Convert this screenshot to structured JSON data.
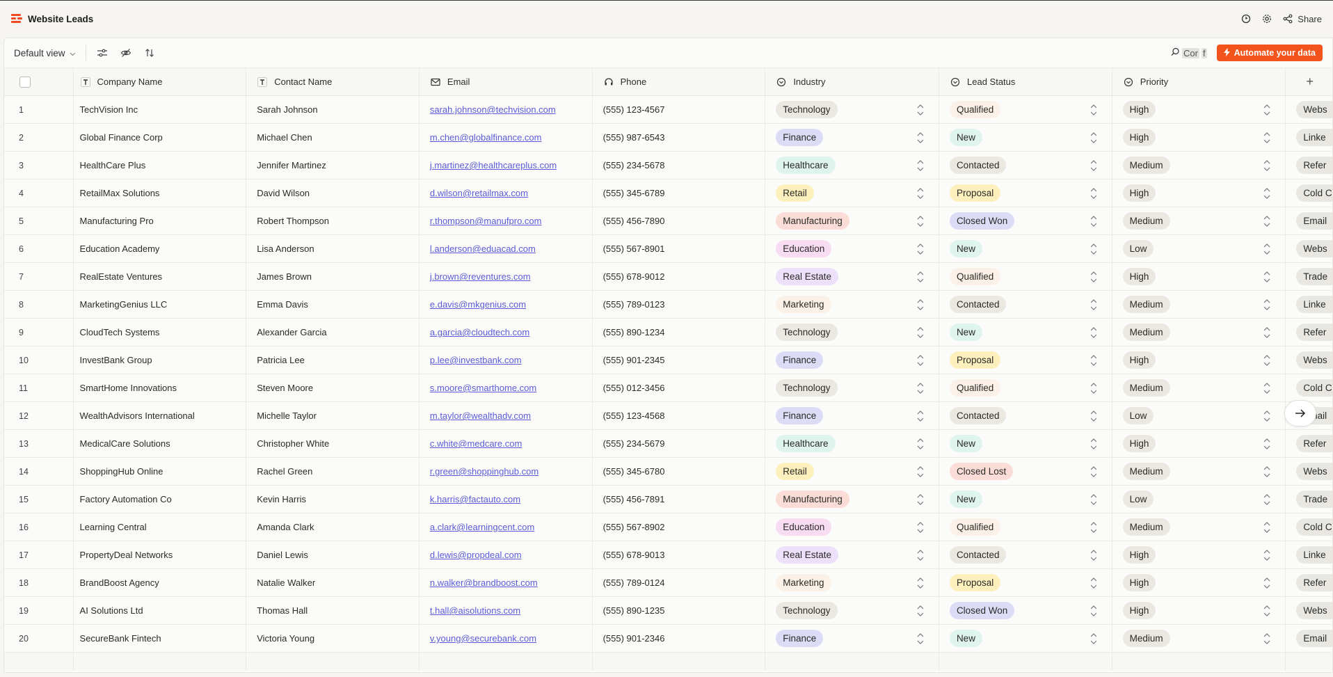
{
  "app": {
    "title": "Website Leads",
    "share_label": "Share"
  },
  "toolbar": {
    "view_label": "Default view",
    "search_text": "Cor",
    "search_highlight": "f",
    "automate_label": "Automate your data"
  },
  "columns": [
    {
      "label": "Company Name",
      "icon": "text-type-icon"
    },
    {
      "label": "Contact Name",
      "icon": "text-type-icon"
    },
    {
      "label": "Email",
      "icon": "mail-icon"
    },
    {
      "label": "Phone",
      "icon": "headset-icon"
    },
    {
      "label": "Industry",
      "icon": "select-icon"
    },
    {
      "label": "Lead Status",
      "icon": "select-icon"
    },
    {
      "label": "Priority",
      "icon": "select-icon"
    }
  ],
  "add_column_label": "+",
  "colors": {
    "accent": "#f2541b",
    "Technology": "#ebe8e2",
    "Finance": "#dcdcf7",
    "Healthcare": "#def4ec",
    "Retail": "#fdf0bd",
    "Manufacturing": "#fbdcd7",
    "Education": "#f7dcf2",
    "Real Estate": "#ece0fa",
    "Marketing": "#fbf1e6",
    "Qualified": "#fcf1e8",
    "New": "#def4ec",
    "Contacted": "#ebe8e2",
    "Proposal": "#fdf0bd",
    "Closed Won": "#dcdcf7",
    "Closed Lost": "#fbdcd7",
    "High": "#ebe8e2",
    "Medium": "#ebe8e2",
    "Low": "#ebe8e2"
  },
  "rows": [
    {
      "n": "1",
      "company": "TechVision Inc",
      "contact": "Sarah Johnson",
      "email": "sarah.johnson@techvision.com",
      "phone": "(555) 123-4567",
      "industry": "Technology",
      "status": "Qualified",
      "priority": "High",
      "source": "Webs"
    },
    {
      "n": "2",
      "company": "Global Finance Corp",
      "contact": "Michael Chen",
      "email": "m.chen@globalfinance.com",
      "phone": "(555) 987-6543",
      "industry": "Finance",
      "status": "New",
      "priority": "High",
      "source": "Linke"
    },
    {
      "n": "3",
      "company": "HealthCare Plus",
      "contact": "Jennifer Martinez",
      "email": "j.martinez@healthcareplus.com",
      "phone": "(555) 234-5678",
      "industry": "Healthcare",
      "status": "Contacted",
      "priority": "Medium",
      "source": "Refer"
    },
    {
      "n": "4",
      "company": "RetailMax Solutions",
      "contact": "David Wilson",
      "email": "d.wilson@retailmax.com",
      "phone": "(555) 345-6789",
      "industry": "Retail",
      "status": "Proposal",
      "priority": "High",
      "source": "Cold C"
    },
    {
      "n": "5",
      "company": "Manufacturing Pro",
      "contact": "Robert Thompson",
      "email": "r.thompson@manufpro.com",
      "phone": "(555) 456-7890",
      "industry": "Manufacturing",
      "status": "Closed Won",
      "priority": "Medium",
      "source": "Email"
    },
    {
      "n": "6",
      "company": "Education Academy",
      "contact": "Lisa Anderson",
      "email": "l.anderson@eduacad.com",
      "phone": "(555) 567-8901",
      "industry": "Education",
      "status": "New",
      "priority": "Low",
      "source": "Webs"
    },
    {
      "n": "7",
      "company": "RealEstate Ventures",
      "contact": "James Brown",
      "email": "j.brown@reventures.com",
      "phone": "(555) 678-9012",
      "industry": "Real Estate",
      "status": "Qualified",
      "priority": "High",
      "source": "Trade"
    },
    {
      "n": "8",
      "company": "MarketingGenius LLC",
      "contact": "Emma Davis",
      "email": "e.davis@mkgenius.com",
      "phone": "(555) 789-0123",
      "industry": "Marketing",
      "status": "Contacted",
      "priority": "Medium",
      "source": "Linke"
    },
    {
      "n": "9",
      "company": "CloudTech Systems",
      "contact": "Alexander Garcia",
      "email": "a.garcia@cloudtech.com",
      "phone": "(555) 890-1234",
      "industry": "Technology",
      "status": "New",
      "priority": "Medium",
      "source": "Refer"
    },
    {
      "n": "10",
      "company": "InvestBank Group",
      "contact": "Patricia Lee",
      "email": "p.lee@investbank.com",
      "phone": "(555) 901-2345",
      "industry": "Finance",
      "status": "Proposal",
      "priority": "High",
      "source": "Webs"
    },
    {
      "n": "11",
      "company": "SmartHome Innovations",
      "contact": "Steven Moore",
      "email": "s.moore@smarthome.com",
      "phone": "(555) 012-3456",
      "industry": "Technology",
      "status": "Qualified",
      "priority": "Medium",
      "source": "Cold C"
    },
    {
      "n": "12",
      "company": "WealthAdvisors International",
      "contact": "Michelle Taylor",
      "email": "m.taylor@wealthadv.com",
      "phone": "(555) 123-4568",
      "industry": "Finance",
      "status": "Contacted",
      "priority": "Low",
      "source": "Email"
    },
    {
      "n": "13",
      "company": "MedicalCare Solutions",
      "contact": "Christopher White",
      "email": "c.white@medcare.com",
      "phone": "(555) 234-5679",
      "industry": "Healthcare",
      "status": "New",
      "priority": "High",
      "source": "Refer"
    },
    {
      "n": "14",
      "company": "ShoppingHub Online",
      "contact": "Rachel Green",
      "email": "r.green@shoppinghub.com",
      "phone": "(555) 345-6780",
      "industry": "Retail",
      "status": "Closed Lost",
      "priority": "Medium",
      "source": "Webs"
    },
    {
      "n": "15",
      "company": "Factory Automation Co",
      "contact": "Kevin Harris",
      "email": "k.harris@factauto.com",
      "phone": "(555) 456-7891",
      "industry": "Manufacturing",
      "status": "New",
      "priority": "Low",
      "source": "Trade"
    },
    {
      "n": "16",
      "company": "Learning Central",
      "contact": "Amanda Clark",
      "email": "a.clark@learningcent.com",
      "phone": "(555) 567-8902",
      "industry": "Education",
      "status": "Qualified",
      "priority": "Medium",
      "source": "Cold C"
    },
    {
      "n": "17",
      "company": "PropertyDeal Networks",
      "contact": "Daniel Lewis",
      "email": "d.lewis@propdeal.com",
      "phone": "(555) 678-9013",
      "industry": "Real Estate",
      "status": "Contacted",
      "priority": "High",
      "source": "Linke"
    },
    {
      "n": "18",
      "company": "BrandBoost Agency",
      "contact": "Natalie Walker",
      "email": "n.walker@brandboost.com",
      "phone": "(555) 789-0124",
      "industry": "Marketing",
      "status": "Proposal",
      "priority": "High",
      "source": "Refer"
    },
    {
      "n": "19",
      "company": "AI Solutions Ltd",
      "contact": "Thomas Hall",
      "email": "t.hall@aisolutions.com",
      "phone": "(555) 890-1235",
      "industry": "Technology",
      "status": "Closed Won",
      "priority": "High",
      "source": "Webs"
    },
    {
      "n": "20",
      "company": "SecureBank Fintech",
      "contact": "Victoria Young",
      "email": "v.young@securebank.com",
      "phone": "(555) 901-2346",
      "industry": "Finance",
      "status": "New",
      "priority": "Medium",
      "source": "Email"
    }
  ]
}
